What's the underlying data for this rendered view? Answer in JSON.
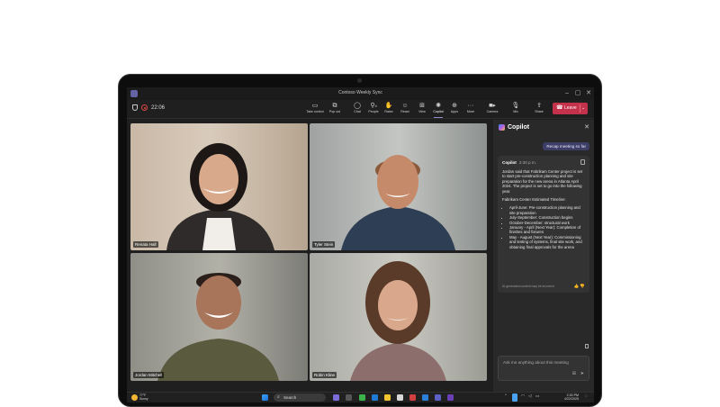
{
  "window": {
    "title": "Contoso Weekly Sync"
  },
  "toolbar": {
    "timer": "22:06",
    "buttons": [
      {
        "label": "Take control",
        "icon": "take-control-icon"
      },
      {
        "label": "Pop out",
        "icon": "pop-out-icon"
      },
      {
        "label": "Chat",
        "icon": "chat-icon"
      },
      {
        "label": "People",
        "icon": "people-icon",
        "count": "4"
      },
      {
        "label": "Raise",
        "icon": "raise-hand-icon"
      },
      {
        "label": "React",
        "icon": "react-icon"
      },
      {
        "label": "View",
        "icon": "view-icon"
      },
      {
        "label": "Copilot",
        "icon": "copilot-icon"
      },
      {
        "label": "Apps",
        "icon": "apps-icon"
      },
      {
        "label": "More",
        "icon": "more-icon"
      },
      {
        "label": "Camera",
        "icon": "camera-icon"
      },
      {
        "label": "Mic",
        "icon": "mic-icon"
      },
      {
        "label": "Share",
        "icon": "share-icon"
      }
    ],
    "leave_label": "Leave",
    "leave_color": "#c4314b"
  },
  "participants": [
    {
      "name": "Renata Hall"
    },
    {
      "name": "Tyler Stein"
    },
    {
      "name": "Jordan Mitchell"
    },
    {
      "name": "Robin Kline"
    }
  ],
  "copilot": {
    "title": "Copilot",
    "prompt": "Recap meeting so far",
    "response": {
      "author": "Copilot",
      "time": "2:30 p.m.",
      "paragraph1": "Jordan said that Fabrikam Center project is set to start pre-construction planning and site preparation for the new arena in Atlanta April 2024. The project is set to go into the following year.",
      "paragraph2": "Fabrikam Center Estimated Timeline:",
      "timeline": [
        "April-June: Pre-construction planning and site preparation",
        "July-September: Construction begins",
        "October-December: structural work",
        "January - April (Next Year): Completion of finishes and fixtures",
        "May - August (Next Year): Commissioning and testing of systems, final site work, and obtaining final approvals for the arena"
      ],
      "ai_note": "AI-generated content may be incorrect"
    },
    "input_placeholder": "Ask me anything about this meeting"
  },
  "taskbar": {
    "weather_temp": "77°F",
    "weather_desc": "Sunny",
    "search_label": "Search",
    "time": "2:30 PM",
    "date": "4/22/2025"
  },
  "colors": {
    "accent": "#6264a7",
    "leave": "#c4314b",
    "panel": "#292929"
  }
}
